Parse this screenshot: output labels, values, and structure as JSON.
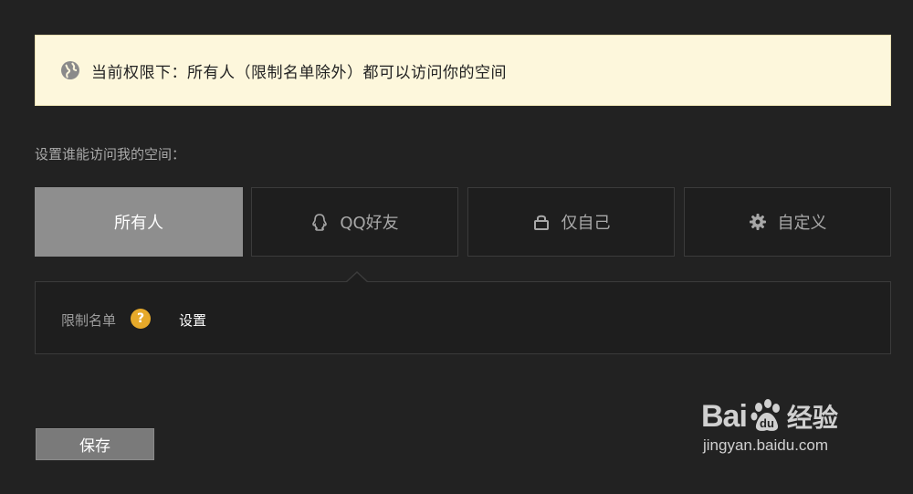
{
  "banner": {
    "text": "当前权限下：所有人（限制名单除外）都可以访问你的空间"
  },
  "section": {
    "label": "设置谁能访问我的空间："
  },
  "options": [
    {
      "label": "所有人",
      "icon": "",
      "active": true
    },
    {
      "label": "QQ好友",
      "icon": "qq-icon",
      "active": false
    },
    {
      "label": "仅自己",
      "icon": "lock-icon",
      "active": false
    },
    {
      "label": "自定义",
      "icon": "gear-icon",
      "active": false
    }
  ],
  "panel": {
    "label": "限制名单",
    "help": "?",
    "link": "设置"
  },
  "save_label": "保存",
  "watermark": {
    "brand_left": "Bai",
    "brand_right": "经验",
    "url": "jingyan.baidu.com"
  },
  "colors": {
    "background": "#222222",
    "banner_bg": "#fdf7dc",
    "active_option": "#8e8e8e",
    "help_badge": "#e6a92a"
  }
}
